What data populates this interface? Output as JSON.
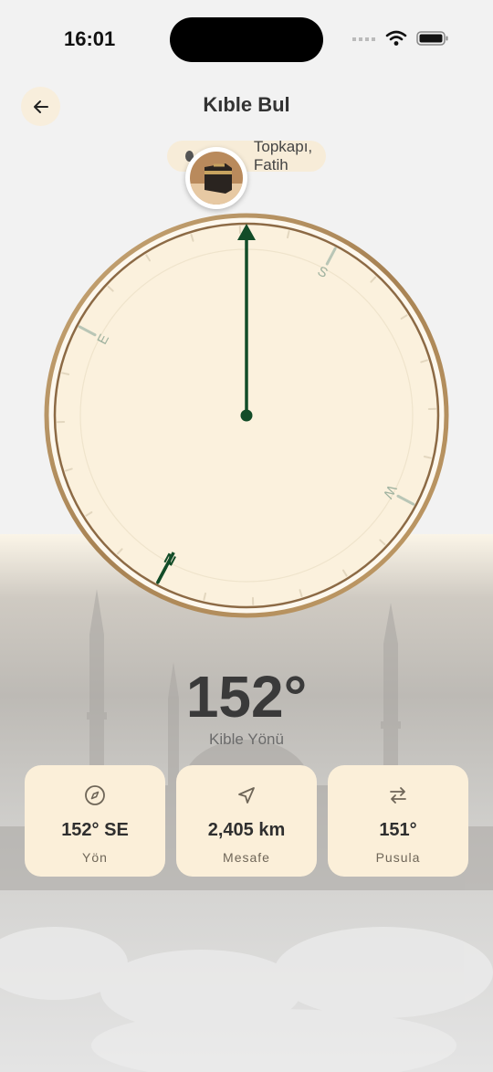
{
  "status_bar": {
    "time": "16:01"
  },
  "header": {
    "title": "Kıble Bul",
    "back_icon": "arrow-left-icon"
  },
  "location": {
    "text": "Topkapı, Fatih"
  },
  "compass": {
    "labels": {
      "north": "N",
      "east": "E",
      "south": "S",
      "west": "W"
    },
    "qibla_heading_deg": 152,
    "colors": {
      "needle": "#124c28",
      "face": "#fbf1dd",
      "ring": "#b58f5c"
    }
  },
  "qibla": {
    "angle": "152°",
    "label": "Kible Yönü"
  },
  "cards": [
    {
      "icon": "compass-icon",
      "value": "152° SE",
      "label": "Yön"
    },
    {
      "icon": "navigation-arrow-icon",
      "value": "2,405 km",
      "label": "Mesafe"
    },
    {
      "icon": "swap-arrows-icon",
      "value": "151°",
      "label": "Pusula"
    }
  ]
}
